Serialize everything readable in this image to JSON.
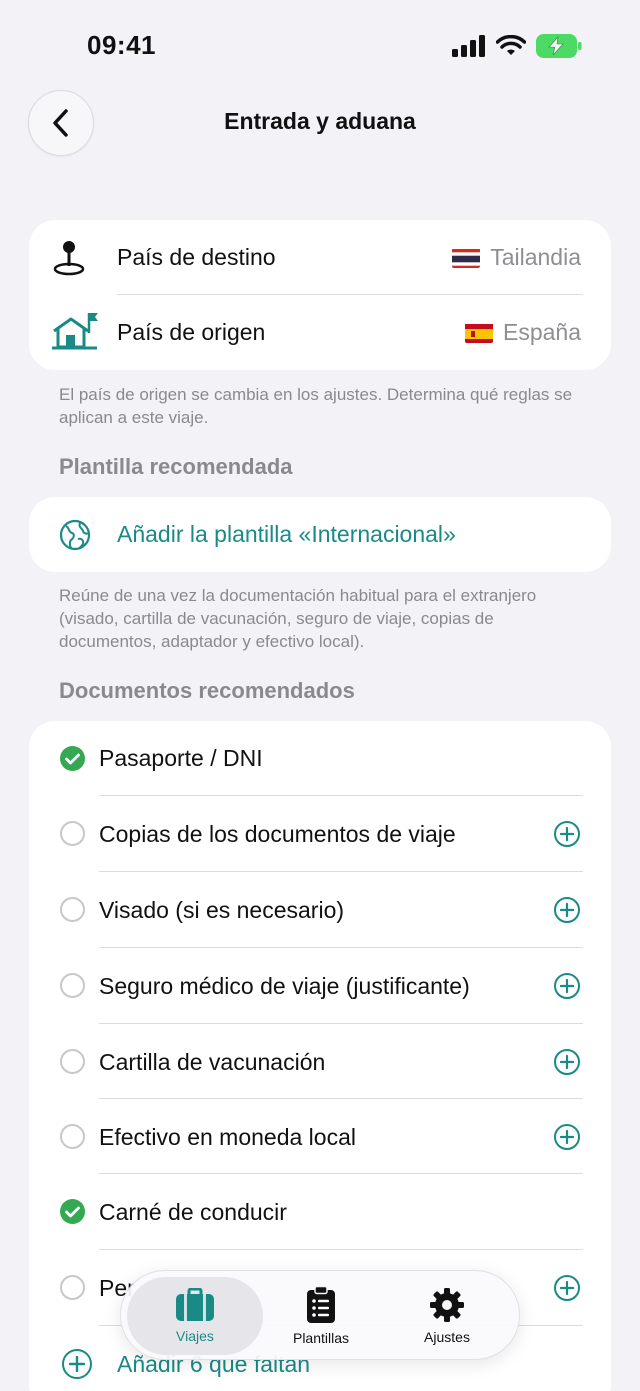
{
  "status_bar": {
    "time": "09:41"
  },
  "header": {
    "title": "Entrada y aduana"
  },
  "destination": {
    "dest_label": "País de destino",
    "dest_value": "Tailandia",
    "origin_label": "País de origen",
    "origin_value": "España"
  },
  "origin_note": "El país de origen se cambia en los ajustes. Determina qué reglas se aplican a este viaje.",
  "template_section": {
    "title": "Plantilla recomendada",
    "add_label": "Añadir la plantilla «Internacional»",
    "note": "Reúne de una vez la documentación habitual para el extranjero (visado, cartilla de vacunación, seguro de viaje, copias de documentos, adaptador y efectivo local)."
  },
  "documents_section": {
    "title": "Documentos recomendados",
    "items": [
      {
        "label": "Pasaporte / DNI",
        "checked": true
      },
      {
        "label": "Copias de los documentos de viaje",
        "checked": false
      },
      {
        "label": "Visado (si es necesario)",
        "checked": false
      },
      {
        "label": "Seguro médico de viaje (justificante)",
        "checked": false
      },
      {
        "label": "Cartilla de vacunación",
        "checked": false
      },
      {
        "label": "Efectivo en moneda local",
        "checked": false
      },
      {
        "label": "Carné de conducir",
        "checked": true
      },
      {
        "label": "Per",
        "checked": false
      }
    ],
    "add_missing_label": "Añadir 6 que faltan"
  },
  "tab_bar": {
    "tabs": [
      {
        "label": "Viajes",
        "icon": "suitcase-icon",
        "active": true
      },
      {
        "label": "Plantillas",
        "icon": "checklist-icon",
        "active": false
      },
      {
        "label": "Ajustes",
        "icon": "gear-icon",
        "active": false
      }
    ]
  },
  "colors": {
    "accent": "#1A8A86",
    "check": "#35A853",
    "background": "#F2F2F7"
  }
}
